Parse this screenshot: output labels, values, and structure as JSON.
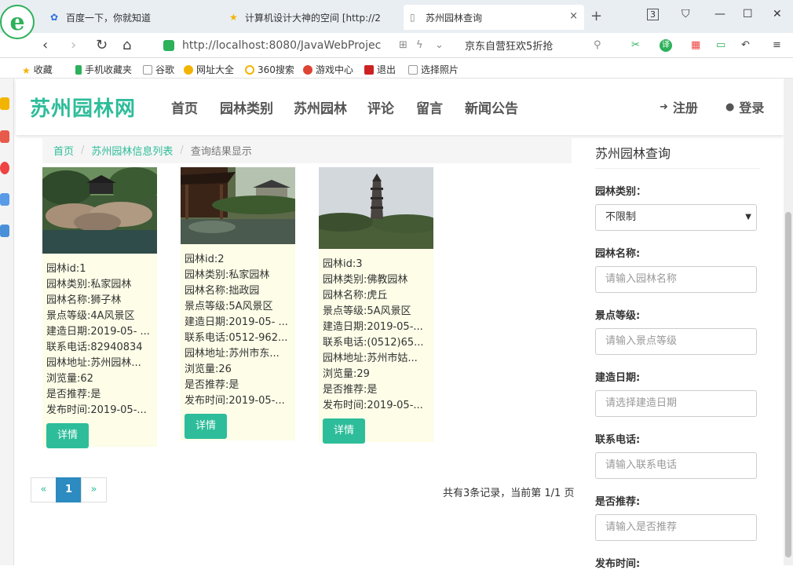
{
  "browser": {
    "tabs": [
      {
        "label": "百度一下，你就知道",
        "icon": "baidu-paw-icon"
      },
      {
        "label": "计算机设计大神的空间 [http://2",
        "icon": "star-icon"
      },
      {
        "label": "苏州园林查询",
        "icon": "page-icon"
      }
    ],
    "tab_close": "×",
    "new_tab": "+",
    "tab_count": "3",
    "url": "http://localhost:8080/JavaWebProjec",
    "search_text": "京东自营狂欢5折抢",
    "bookmarks": [
      "收藏",
      "手机收藏夹",
      "谷歌",
      "网址大全",
      "360搜索",
      "游戏中心",
      "退出",
      "选择照片"
    ]
  },
  "site": {
    "brand": "苏州园林网",
    "brand_color": "#2ebd9a",
    "menu": [
      "首页",
      "园林类别",
      "苏州园林",
      "评论",
      "留言",
      "新闻公告"
    ],
    "register": "注册",
    "login": "登录"
  },
  "breadcrumb": {
    "home": "首页",
    "list": "苏州园林信息列表",
    "current": "查询结果显示",
    "sep": "/"
  },
  "cards": [
    {
      "lines": [
        "园林id:1",
        "园林类别:私家园林",
        "园林名称:狮子林",
        "景点等级:4A风景区",
        "建造日期:2019-05- ...",
        "联系电话:82940834",
        "园林地址:苏州园林...",
        "浏览量:62",
        "是否推荐:是",
        "发布时间:2019-05-..."
      ],
      "button": "详情"
    },
    {
      "lines": [
        "园林id:2",
        "园林类别:私家园林",
        "园林名称:拙政园",
        "景点等级:5A风景区",
        "建造日期:2019-05- ...",
        "联系电话:0512-962...",
        "园林地址:苏州市东...",
        "浏览量:26",
        "是否推荐:是",
        "发布时间:2019-05-..."
      ],
      "button": "详情"
    },
    {
      "lines": [
        "园林id:3",
        "园林类别:佛教园林",
        "园林名称:虎丘",
        "景点等级:5A风景区",
        "建造日期:2019-05-...",
        "联系电话:(0512)65...",
        "园林地址:苏州市姑...",
        "浏览量:29",
        "是否推荐:是",
        "发布时间:2019-05-..."
      ],
      "button": "详情"
    }
  ],
  "pager": {
    "prev": "«",
    "page": "1",
    "next": "»",
    "info": "共有3条记录，当前第 1/1 页"
  },
  "sidebar": {
    "title": "苏州园林查询",
    "fields": [
      {
        "label": "园林类别：",
        "value": "不限制",
        "type": "select"
      },
      {
        "label": "园林名称:",
        "placeholder": "请输入园林名称"
      },
      {
        "label": "景点等级:",
        "placeholder": "请输入景点等级"
      },
      {
        "label": "建造日期:",
        "placeholder": "请选择建造日期"
      },
      {
        "label": "联系电话:",
        "placeholder": "请输入联系电话"
      },
      {
        "label": "是否推荐:",
        "placeholder": "请输入是否推荐"
      },
      {
        "label": "发布时间:",
        "placeholder": ""
      }
    ]
  }
}
